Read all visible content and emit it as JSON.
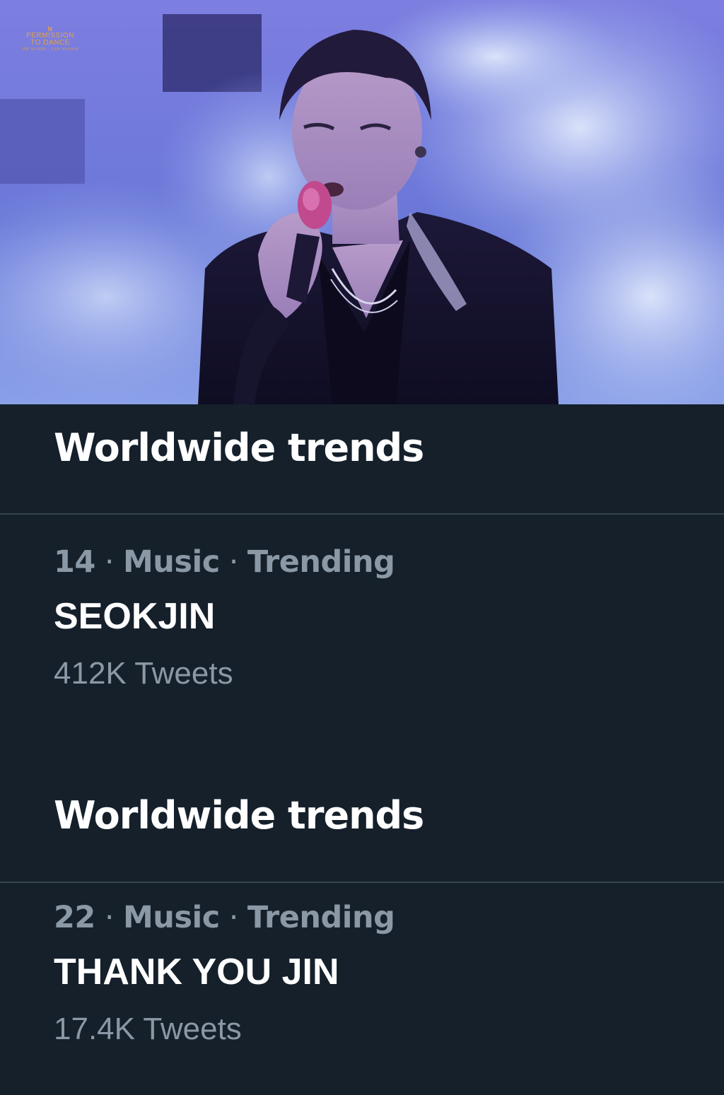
{
  "photo": {
    "watermark": {
      "mark": "N",
      "line1": "PERMISSION",
      "line2": "TO DANCE",
      "line3": "ON STAGE · LAS VEGAS"
    },
    "colors": {
      "background": "#6a74d8",
      "smoke": "#c9d6f5",
      "jacket": "#121028"
    }
  },
  "sections": [
    {
      "title": "Worldwide trends",
      "trend": {
        "rank": "14",
        "category": "Music",
        "status": "Trending",
        "separator": "·",
        "name": "SEOKJIN",
        "count": "412K Tweets"
      }
    },
    {
      "title": "Worldwide trends",
      "trend": {
        "rank": "22",
        "category": "Music",
        "status": "Trending",
        "separator": "·",
        "name": "THANK YOU JIN",
        "count": "17.4K Tweets"
      }
    }
  ],
  "colors": {
    "background": "#15202b",
    "divider": "#38444d",
    "primary_text": "#ffffff",
    "secondary_text": "#8b98a5"
  }
}
